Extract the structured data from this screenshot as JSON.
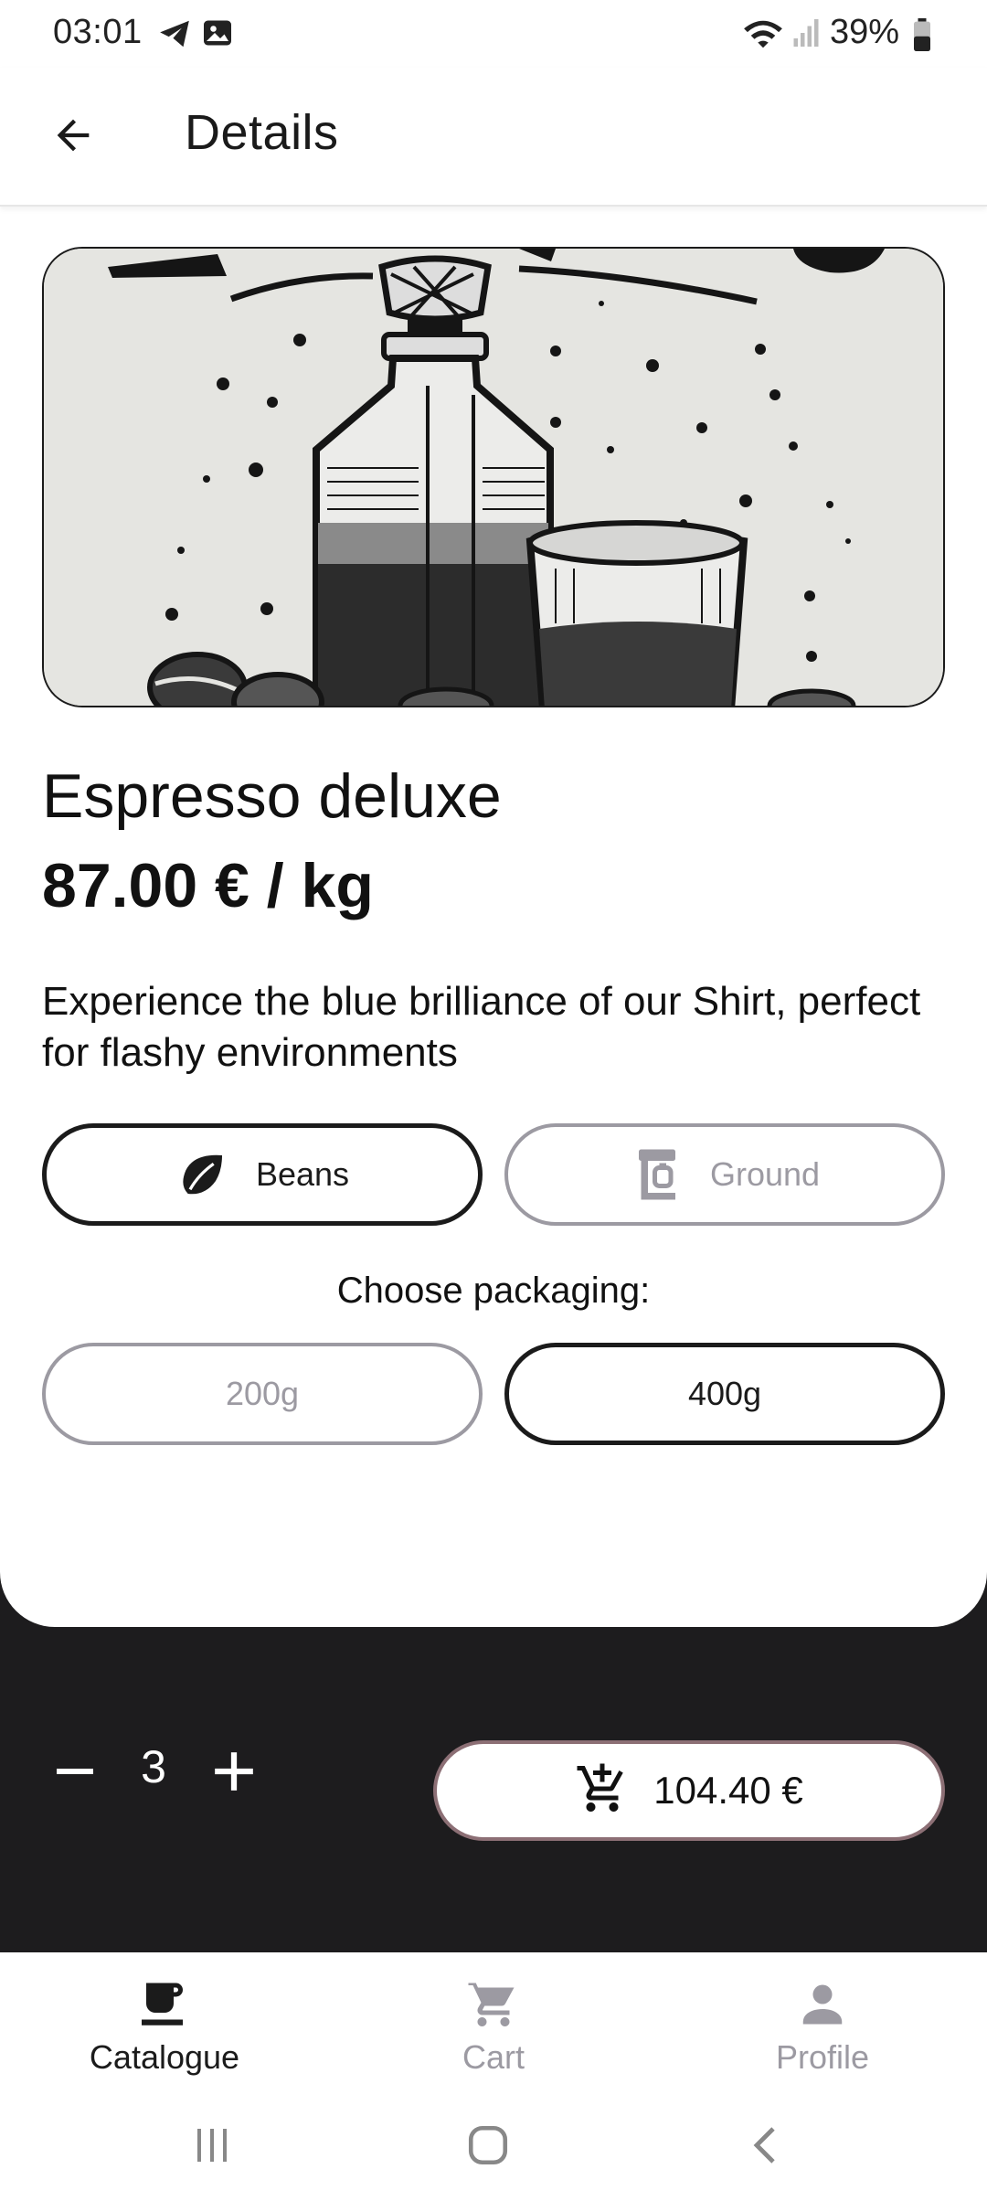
{
  "status": {
    "time": "03:01",
    "battery": "39%",
    "icons": [
      "telegram-icon",
      "gallery-icon",
      "wifi-icon",
      "signal-icon",
      "battery-icon"
    ]
  },
  "app_bar": {
    "title": "Details",
    "back_icon": "arrow-back-icon"
  },
  "product": {
    "name": "Espresso deluxe",
    "price": "87.00 € / kg",
    "description": "Experience the blue brilliance of our Shirt, perfect for flashy environments",
    "image_icon": "coffee-illustration"
  },
  "grind_options": [
    {
      "label": "Beans",
      "icon": "leaf-icon",
      "selected": true
    },
    {
      "label": "Ground",
      "icon": "coffee-grinder-icon",
      "selected": false
    }
  ],
  "packaging": {
    "label": "Choose packaging:",
    "options": [
      {
        "label": "200g",
        "selected": false
      },
      {
        "label": "400g",
        "selected": true
      }
    ]
  },
  "cart_bar": {
    "quantity": "3",
    "minus_icon": "minus-icon",
    "plus_icon": "plus-icon",
    "total": "104.40 €",
    "cart_icon": "add-shopping-cart-icon"
  },
  "bottom_nav": [
    {
      "label": "Catalogue",
      "icon": "coffee-cup-icon",
      "active": true
    },
    {
      "label": "Cart",
      "icon": "shopping-cart-icon",
      "active": false
    },
    {
      "label": "Profile",
      "icon": "person-icon",
      "active": false
    }
  ],
  "colors": {
    "dark_panel": "#1d1c1e",
    "selected_border": "#1b1b1b",
    "unselected_border": "#9c9aa2",
    "cart_button_border": "#8c6f75"
  }
}
